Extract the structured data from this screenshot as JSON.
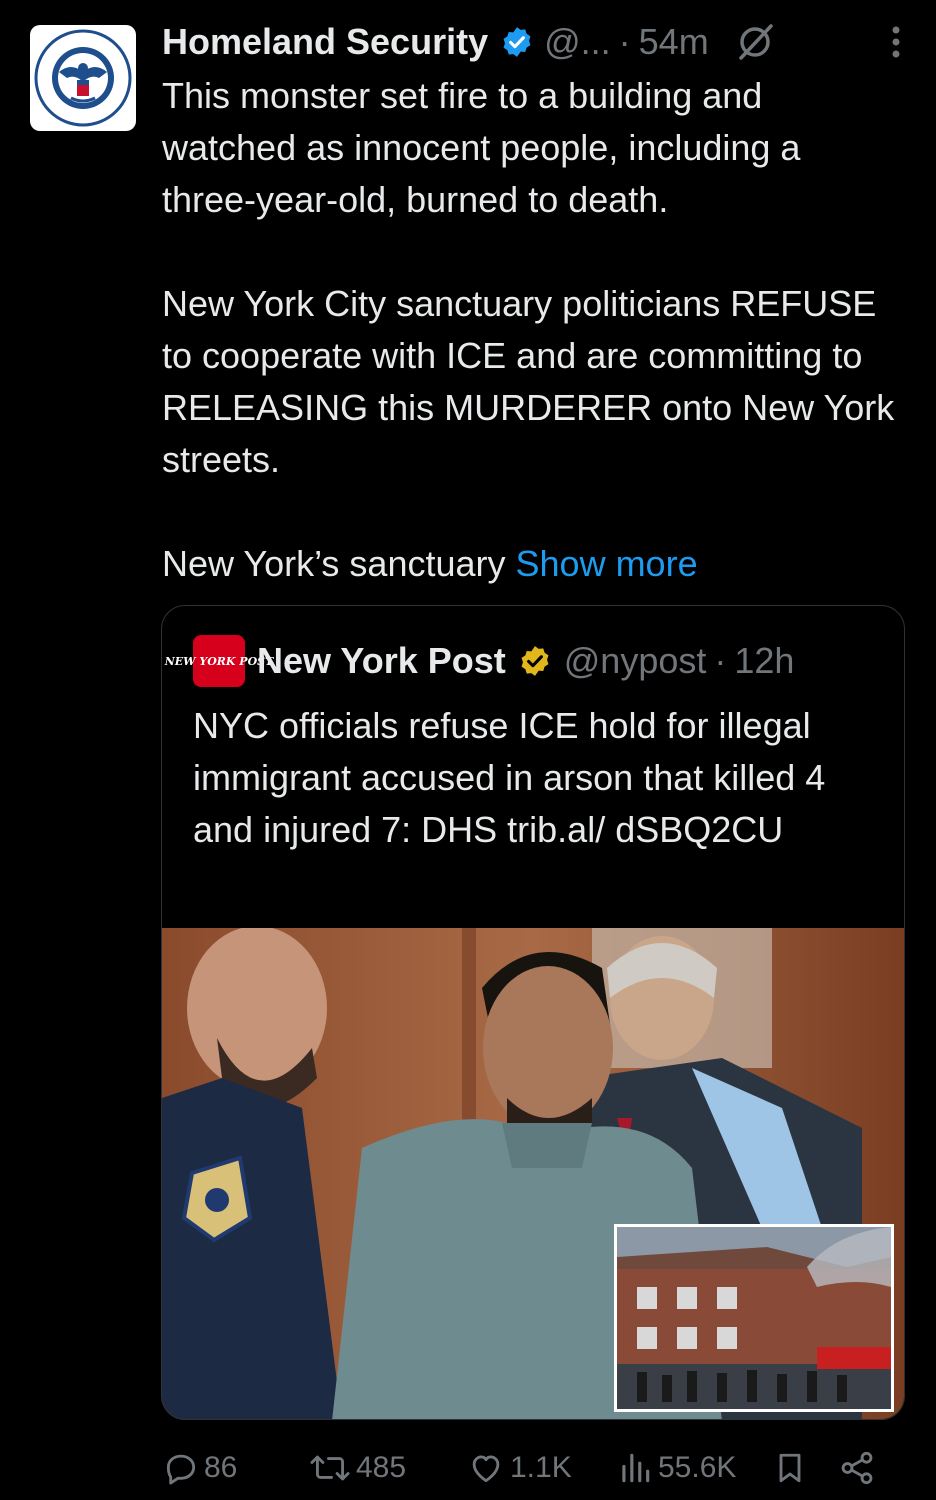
{
  "tweet": {
    "author_name": "Homeland Security",
    "handle": "@...",
    "separator": "·",
    "time": "54m",
    "paragraphs": [
      "This monster set fire to a building and watched as innocent people, including a three-year-old, burned to death.",
      "New York City sanctuary politicians REFUSE to cooperate with ICE and are committing to RELEASING this MURDERER onto New York streets."
    ],
    "truncated_text": "New York’s sanctuary ",
    "show_more": "Show more",
    "avatar_seal_text": "U.S. DEPARTMENT OF HOMELAND SECURITY"
  },
  "quote": {
    "logo_text": "NEW YORK POST",
    "author_name": "New York Post",
    "handle": "@nypost",
    "separator": "·",
    "time": "12h",
    "text": "NYC officials refuse ICE hold for illegal immigrant accused in arson that killed 4 and injured 7: DHS trib.al/ dSBQ2CU",
    "photo_patch_text": "POLICE DEPARTMENT CITY OF NEW YORK"
  },
  "actions": {
    "replies": "86",
    "reposts": "485",
    "likes": "1.1K",
    "views": "55.6K"
  },
  "colors": {
    "background": "#000000",
    "text": "#e7e9ea",
    "muted": "#71767b",
    "link": "#1d9bf0",
    "verified_blue": "#1d9bf0",
    "verified_gold": "#e2b719",
    "nypost_red": "#d6001c"
  },
  "icons": [
    "verified-icon",
    "grok-icon",
    "more-icon",
    "gold-verified-icon",
    "reply-icon",
    "repost-icon",
    "like-icon",
    "views-icon",
    "bookmark-icon",
    "share-icon"
  ]
}
